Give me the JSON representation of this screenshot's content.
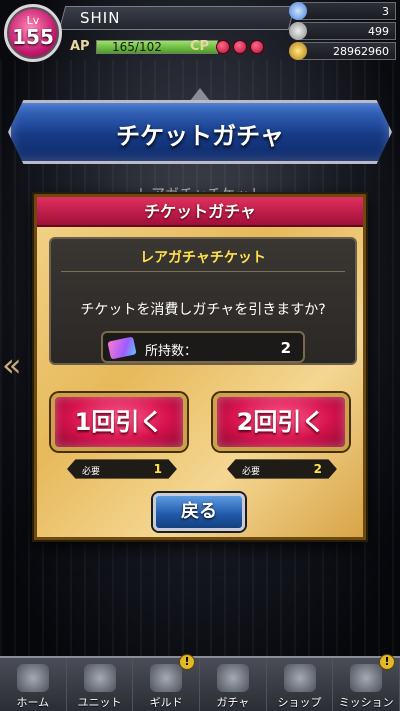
{
  "header": {
    "level_label": "Lv",
    "level_value": "155",
    "player_name": "SHIN",
    "ap_label": "AP",
    "ap_value": "165/102",
    "ap_fill_fraction": 1.0,
    "cp_label": "CP",
    "cp_count": 3,
    "gems": "3",
    "stones": "499",
    "gold": "28962960"
  },
  "screen": {
    "title": "チケットガチャ",
    "background_ticket_text": "レアガチャチケット"
  },
  "dialog": {
    "title": "チケットガチャ",
    "ticket_name": "レアガチャチケット",
    "question": "チケットを消費しガチャを引きますか?",
    "owned_label": "所持数：",
    "owned_value": "2",
    "pull_one_label": "1回引く",
    "pull_two_label": "2回引く",
    "required_label": "必要",
    "required_one": "1",
    "required_two": "2",
    "back_label": "戻る"
  },
  "nav": [
    {
      "label": "ホーム",
      "icon": "home-icon",
      "alert": false
    },
    {
      "label": "ユニット",
      "icon": "unit-icon",
      "alert": false
    },
    {
      "label": "ギルド",
      "icon": "guild-icon",
      "alert": true
    },
    {
      "label": "ガチャ",
      "icon": "gacha-icon",
      "alert": false
    },
    {
      "label": "ショップ",
      "icon": "shop-icon",
      "alert": false
    },
    {
      "label": "ミッション",
      "icon": "mission-icon",
      "alert": true
    }
  ],
  "alert_mark": "!",
  "colors": {
    "accent_pink": "#d5124c",
    "panel_gold": "#e7b95b",
    "banner_blue": "#163a86",
    "highlight_yellow": "#ffe14d"
  }
}
